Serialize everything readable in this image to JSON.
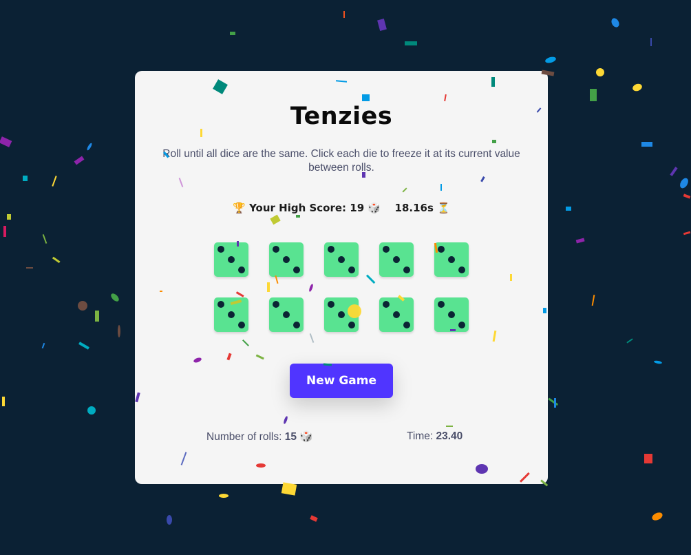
{
  "game": {
    "title": "Tenzies",
    "instructions": "Roll until all dice are the same. Click each die to freeze it at its current value between rolls.",
    "high_score": {
      "trophy_icon": "🏆",
      "label": "Your High Score: 19",
      "dice_icon": "🎲",
      "time": "18.16s",
      "hourglass_icon": "⏳"
    },
    "dice": [
      3,
      3,
      3,
      3,
      3,
      3,
      3,
      3,
      3,
      3
    ],
    "new_game_label": "New Game",
    "rolls_label": "Number of rolls:",
    "rolls_value": "15",
    "rolls_icon": "🎲",
    "time_label": "Time:",
    "time_value": "23.40"
  },
  "colors": {
    "background": "#0b2134",
    "card": "#f5f5f5",
    "die": "#59e391",
    "pip": "#0b2434",
    "button": "#5035ff"
  }
}
